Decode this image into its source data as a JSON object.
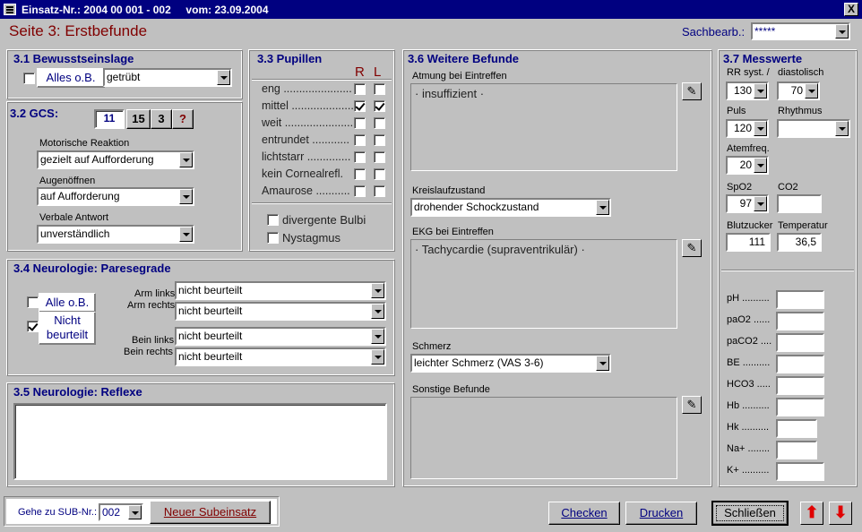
{
  "window": {
    "title": "Einsatz-Nr.: 2004 00 001 - 002     vom: 23.09.2004",
    "close_label": "X"
  },
  "page_heading": "Seite 3: Erstbefunde",
  "sachbearb": {
    "label": "Sachbearb.:",
    "value": "*****"
  },
  "s31": {
    "title": "3.1 Bewusstseinslage",
    "alles_ob": "Alles o.B.",
    "state": "getrübt"
  },
  "s32": {
    "title": "3.2 GCS:",
    "total": "11",
    "btn15": "15",
    "btn3": "3",
    "btnq": "?",
    "motor_label": "Motorische Reaktion",
    "motor_value": "gezielt auf Aufforderung",
    "augen_label": "Augenöffnen",
    "augen_value": "auf Aufforderung",
    "verbal_label": "Verbale Antwort",
    "verbal_value": "unverständlich"
  },
  "s33": {
    "title": "3.3 Pupillen",
    "col_r": "R",
    "col_l": "L",
    "rows": [
      {
        "label": "eng ......................",
        "r": false,
        "l": false
      },
      {
        "label": "mittel ....................",
        "r": true,
        "l": true
      },
      {
        "label": "weit .......................",
        "r": false,
        "l": false
      },
      {
        "label": "entrundet ............",
        "r": false,
        "l": false
      },
      {
        "label": "lichtstarr ..............",
        "r": false,
        "l": false
      },
      {
        "label": "kein Cornealrefl.",
        "r": false,
        "l": false
      },
      {
        "label": "Amaurose ...........",
        "r": false,
        "l": false
      }
    ],
    "divergente": "divergente Bulbi",
    "nystagmus": "Nystagmus"
  },
  "s34": {
    "title": "3.4 Neurologie: Paresegrade",
    "alle_ob": "Alle o.B.",
    "nicht_beurteilt": "Nicht beurteilt",
    "arm_links": "Arm links",
    "arm_rechts": "Arm rechts",
    "bein_links": "Bein links",
    "bein_rechts": "Bein rechts",
    "arm_links_value": "nicht beurteilt",
    "arm_rechts_value": "nicht beurteilt",
    "bein_links_value": "nicht beurteilt",
    "bein_rechts_value": "nicht beurteilt"
  },
  "s35": {
    "title": "3.5 Neurologie: Reflexe"
  },
  "s36": {
    "title": "3.6 Weitere Befunde",
    "atmung_label": "Atmung bei Eintreffen",
    "atmung_text": "· insuffizient ·",
    "kreislauf_label": "Kreislaufzustand",
    "kreislauf_value": "drohender Schockzustand",
    "ekg_label": "EKG bei Eintreffen",
    "ekg_text": "· Tachycardie (supraventrikulär) ·",
    "schmerz_label": "Schmerz",
    "schmerz_value": "leichter Schmerz (VAS 3-6)",
    "sonstige_label": "Sonstige Befunde"
  },
  "s37": {
    "title": "3.7 Messwerte",
    "rr_label": "RR syst. /",
    "dia_label": "diastolisch",
    "rr_value": "130",
    "dia_value": "70",
    "puls_label": "Puls",
    "rhythmus_label": "Rhythmus",
    "puls_value": "120",
    "atem_label": "Atemfreq.",
    "atem_value": "20",
    "spo2_label": "SpO2",
    "co2_label": "CO2",
    "spo2_value": "97",
    "bz_label": "Blutzucker",
    "temp_label": "Temperatur",
    "bz_value": "111",
    "temp_value": "36,5",
    "labs": [
      "pH ..........",
      "paO2 ......",
      "paCO2 ....",
      "BE ..........",
      "HCO3 .....",
      "Hb ..........",
      "Hk ..........",
      "Na+ ........",
      "K+ .........."
    ]
  },
  "footer": {
    "goto_label": "Gehe zu SUB-Nr.:",
    "goto_value": "002",
    "neuer": "Neuer Subeinsatz",
    "checken": "Checken",
    "drucken": "Drucken",
    "schliessen": "Schließen"
  }
}
